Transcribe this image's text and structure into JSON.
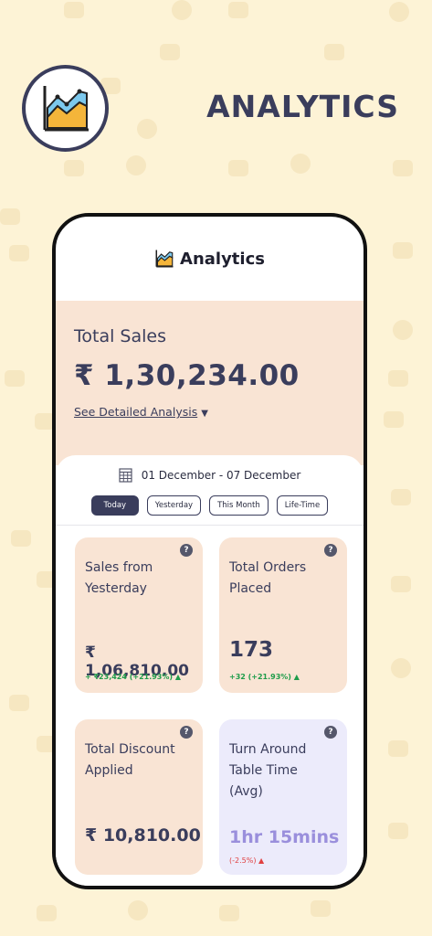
{
  "promo": {
    "title": "ANALYTICS"
  },
  "app": {
    "title": "Analytics"
  },
  "sales": {
    "label": "Total Sales",
    "value": "₹ 1,30,234.00",
    "detail_link": "See Detailed Analysis",
    "caret": "▼"
  },
  "date_range": "01 December - 07 December",
  "tabs": [
    {
      "label": "Today",
      "active": true
    },
    {
      "label": "Yesterday",
      "active": false
    },
    {
      "label": "This Month",
      "active": false
    },
    {
      "label": "Life-Time",
      "active": false
    }
  ],
  "cards": {
    "sales_yesterday": {
      "title_line1": "Sales from",
      "title_line2": "Yesterday",
      "value": "₹ 1,06,810.00",
      "delta": "+ ₹23,424 (+21.93%) ▲"
    },
    "total_orders": {
      "title_line1": "Total Orders",
      "title_line2": "Placed",
      "value": "173",
      "delta": "+32 (+21.93%) ▲"
    },
    "total_discount": {
      "title_line1": "Total Discount",
      "title_line2": "Applied",
      "value": "₹ 10,810.00"
    },
    "turnaround": {
      "title_line1": "Turn Around",
      "title_line2": "Table Time",
      "title_line3": "(Avg)",
      "value": "1hr 15mins",
      "delta": "(-2.5%) ▲"
    }
  },
  "help_glyph": "?",
  "colors": {
    "background": "#fdf3d6",
    "navy": "#3a3d5c",
    "peach": "#f9e4d4",
    "lavender": "#ecebfb",
    "positive": "#1f9c4a",
    "negative": "#e04040"
  },
  "icons": {
    "logo": "line-chart-icon",
    "calendar": "calendar-icon",
    "help": "question-icon"
  }
}
